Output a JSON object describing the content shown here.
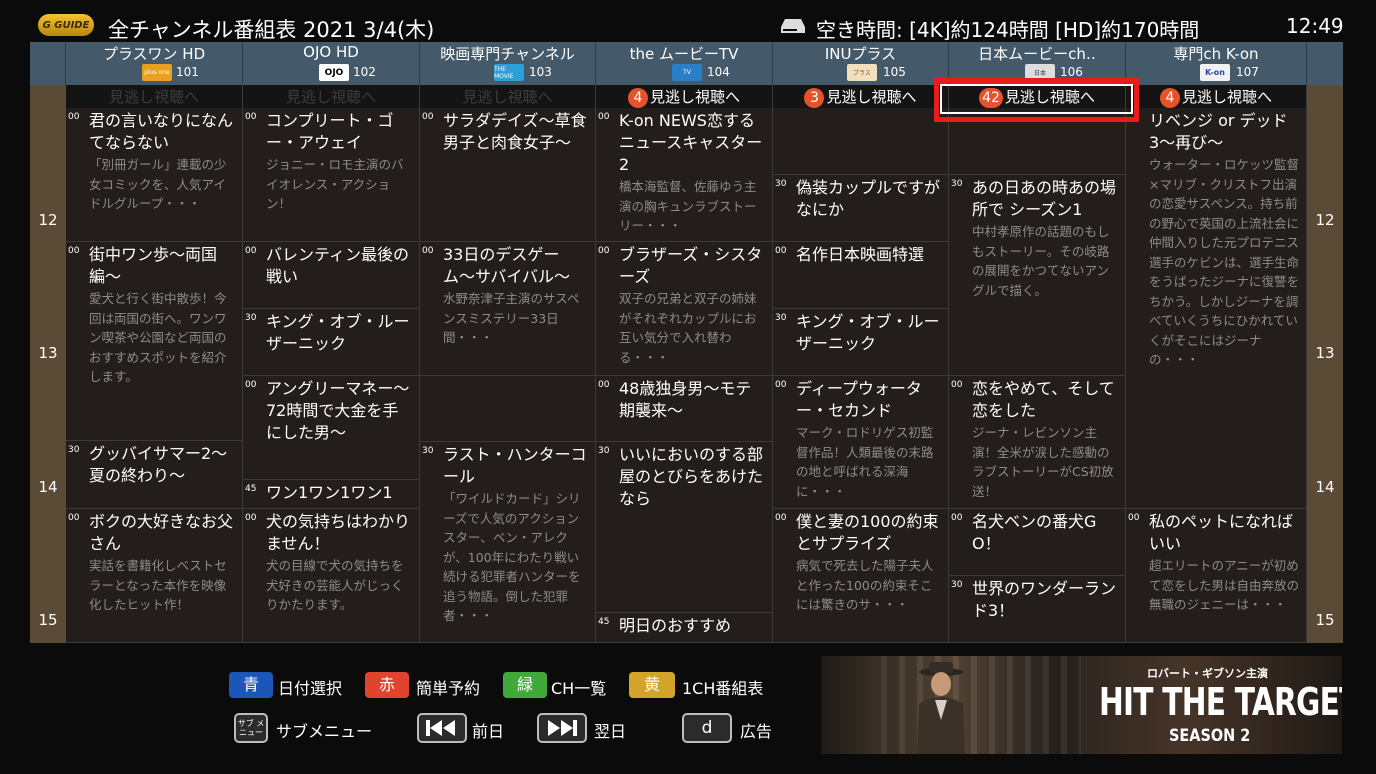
{
  "header": {
    "logo_text": "G GUIDE",
    "title": "全チャンネル番組表  2021  3/4(木)",
    "free_time": "空き時間: [4K]約124時間  [HD]約170時間",
    "clock": "12:49"
  },
  "channels": [
    {
      "name": "プラスワン HD",
      "number": "101",
      "logo": "plus one",
      "logo_color": "#e8a020"
    },
    {
      "name": "OJO HD",
      "number": "102",
      "logo": "OJO",
      "logo_color": "#ffffff"
    },
    {
      "name": "映画専門チャンネル",
      "number": "103",
      "logo": "THE MOVIE",
      "logo_color": "#2aa0d8"
    },
    {
      "name": "the ムービーTV",
      "number": "104",
      "logo": "TV",
      "logo_color": "#2a80c8"
    },
    {
      "name": "INUプラス",
      "number": "105",
      "logo": "プラス",
      "logo_color": "#f0e0c0"
    },
    {
      "name": "日本ムービーch‥",
      "number": "106",
      "logo": "日本",
      "logo_color": "#dddddd"
    },
    {
      "name": "専門ch K-on",
      "number": "107",
      "logo": "K-on",
      "logo_color": "#2a4aa8"
    }
  ],
  "hours": [
    "12",
    "13",
    "14",
    "15"
  ],
  "catchup": [
    {
      "label": "見逃し視聴へ",
      "badge": "",
      "active": false
    },
    {
      "label": "見逃し視聴へ",
      "badge": "",
      "active": false
    },
    {
      "label": "見逃し視聴へ",
      "badge": "",
      "active": false
    },
    {
      "label": "見逃し視聴へ",
      "badge": "4",
      "active": true
    },
    {
      "label": "見逃し視聴へ",
      "badge": "3",
      "active": true
    },
    {
      "label": "見逃し視聴へ",
      "badge": "42",
      "active": true
    },
    {
      "label": "見逃し視聴へ",
      "badge": "4",
      "active": true
    }
  ],
  "programs": {
    "ch101": [
      {
        "min": "00",
        "title": "君の言いなりになんてならない",
        "desc": "「別冊ガール」連載の少女コミックを、人気アイドルグループ・・・"
      },
      {
        "min": "00",
        "title": "街中ワン歩〜両国編〜",
        "desc": "愛犬と行く街中散歩！今回は両国の街へ。ワンワン喫茶や公園など両国のおすすめスポットを紹介します。"
      },
      {
        "min": "30",
        "title": "グッバイサマー2〜夏の終わり〜",
        "desc": ""
      },
      {
        "min": "00",
        "title": "ボクの大好きなお父さん",
        "desc": "実話を書籍化しベストセラーとなった本作を映像化したヒット作！"
      }
    ],
    "ch102": [
      {
        "min": "00",
        "title": "コンプリート・ゴー・アウェイ",
        "desc": "ジョニー・ロモ主演のバイオレンス・アクション！"
      },
      {
        "min": "00",
        "title": "バレンティン最後の戦い",
        "desc": ""
      },
      {
        "min": "30",
        "title": "キング・オブ・ルーザーニック",
        "desc": ""
      },
      {
        "min": "00",
        "title": "アングリーマネー〜72時間で大金を手にした男〜",
        "desc": ""
      },
      {
        "min": "45",
        "title": "ワン1ワン1ワン1",
        "desc": ""
      },
      {
        "min": "00",
        "title": "犬の気持ちはわかりません！",
        "desc": "犬の目線で犬の気持ちを犬好きの芸能人がじっくりかたります。"
      }
    ],
    "ch103": [
      {
        "min": "00",
        "title": "サラダデイズ〜草食男子と肉食女子〜",
        "desc": ""
      },
      {
        "min": "00",
        "title": "33日のデスゲーム〜サバイバル〜",
        "desc": "水野奈津子主演のサスペンスミステリー33日間・・・"
      },
      {
        "min": "30",
        "title": "ラスト・ハンターコール",
        "desc": "「ワイルドカード」シリーズで人気のアクションスター、ベン・アレクが、100年にわたり戦い続ける犯罪者ハンターを追う物語。倒した犯罪者・・・"
      }
    ],
    "ch104": [
      {
        "min": "00",
        "title": "K-on NEWS恋するニュースキャスター2",
        "desc": "橋本海監督、佐藤ゆう主演の胸キュンラブストーリー・・・"
      },
      {
        "min": "00",
        "title": "ブラザーズ・シスターズ",
        "desc": "双子の兄弟と双子の姉妹がそれぞれカップルにお互い気分で入れ替わる・・・"
      },
      {
        "min": "00",
        "title": "48歳独身男〜モテ期襲来〜",
        "desc": ""
      },
      {
        "min": "30",
        "title": "いいにおいのする部屋のとびらをあけたなら",
        "desc": ""
      },
      {
        "min": "45",
        "title": "明日のおすすめ",
        "desc": ""
      }
    ],
    "ch105": [
      {
        "min": "30",
        "title": "偽装カップルですがなにか",
        "desc": ""
      },
      {
        "min": "00",
        "title": "名作日本映画特選",
        "desc": ""
      },
      {
        "min": "30",
        "title": "キング・オブ・ルーザーニック",
        "desc": ""
      },
      {
        "min": "00",
        "title": "ディープウォーター・セカンド",
        "desc": "マーク・ロドリゲス初監督作品！人類最後の末路の地と呼ばれる深海に・・・"
      },
      {
        "min": "00",
        "title": "僕と妻の100の約束とサプライズ",
        "desc": "病気で死去した陽子夫人と作った100の約束そこには驚きのサ・・・"
      }
    ],
    "ch106": [
      {
        "min": "30",
        "title": "あの日あの時あの場所で シーズン1",
        "desc": "中村孝原作の話題のもしもストーリー。その岐路の展開をかつてないアングルで描く。"
      },
      {
        "min": "00",
        "title": "恋をやめて、そして恋をした",
        "desc": "ジーナ・レビンソン主演！全米が涙した感動のラブストーリーがCS初放送！"
      },
      {
        "min": "00",
        "title": "名犬ベンの番犬GO！",
        "desc": ""
      },
      {
        "min": "30",
        "title": "世界のワンダーランド3！",
        "desc": ""
      }
    ],
    "ch107": [
      {
        "min": "",
        "title": "リベンジ or デッド3〜再び〜",
        "desc": "ウォーター・ロケッツ監督×マリブ・クリストフ出演の恋愛サスペンス。持ち前の野心で英国の上流社会に仲間入りした元プロテニス選手のケビンは、選手生命をうばったジーナに復讐をちかう。しかしジーナを調べていくうちにひかれていくがそこにはジーナの・・・"
      },
      {
        "min": "00",
        "title": "私のペットになればいい",
        "desc": "超エリートのアニーが初めて恋をした男は自由奔放の無職のジェニーは・・・"
      }
    ]
  },
  "legend": {
    "blue_key": "青",
    "blue_label": "日付選択",
    "red_key": "赤",
    "red_label": "簡単予約",
    "green_key": "緑",
    "green_label": "CH一覧",
    "yellow_key": "黄",
    "yellow_label": "1CH番組表",
    "submenu_key": "サブ メニュー",
    "submenu_label": "サブメニュー",
    "prev_label": "前日",
    "next_label": "翌日",
    "d_key": "d",
    "d_label": "広告",
    "colors": {
      "blue": "#1b56b8",
      "red": "#e0442e",
      "green": "#3faa3a",
      "yellow": "#d2a52a"
    }
  },
  "ad": {
    "subtitle": "ロバート・ギブソン主演",
    "title": "HIT THE TARGET",
    "season": "SEASON 2"
  },
  "colors": {
    "focus": "#e81c1c",
    "header_bg": "#445a6a",
    "hour_bg": "#5a4a36",
    "cell_bg": "#231e1b"
  }
}
